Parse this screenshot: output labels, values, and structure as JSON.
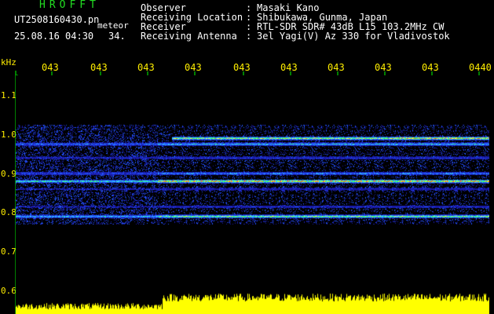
{
  "header": {
    "title": "HROFFT",
    "filename": "UT2508160430.pn",
    "meteor_label": "meteor",
    "datetime": "25.08.16 04:30",
    "count": "34."
  },
  "station": [
    {
      "label": "Observer",
      "value": "Masaki Kano"
    },
    {
      "label": "Receiving Location",
      "value": "Shibukawa, Gunma, Japan"
    },
    {
      "label": "Receiver",
      "value": "RTL-SDR SDR# 43dB L15 103.2MHz CW"
    },
    {
      "label": "Receiving Antenna",
      "value": "3el Yagi(V) Az 330 for Vladivostok"
    }
  ],
  "axes": {
    "unit_label": "kHz",
    "time_ticks": [
      "043",
      "043",
      "043",
      "043",
      "043",
      "043",
      "043",
      "043",
      "043",
      "0440"
    ],
    "freq_ticks": [
      "1.1",
      "1.0",
      "0.9",
      "0.8",
      "0.7",
      "0.6"
    ]
  },
  "colors": {
    "background": "#000000",
    "label_yellow": "#ffee00",
    "title_green": "#22dd22",
    "text_white": "#ffffff",
    "tick_green": "#00ff00"
  },
  "chart_data": {
    "type": "heatmap",
    "title": "",
    "xlabel": "",
    "ylabel": "kHz",
    "ylim": [
      0.6,
      1.15
    ],
    "time_ticks": [
      "043",
      "043",
      "043",
      "043",
      "043",
      "043",
      "043",
      "043",
      "043",
      "0440"
    ],
    "freq_ticks": [
      1.1,
      1.0,
      0.9,
      0.8,
      0.7,
      0.6
    ],
    "signal_lines_khz": [
      {
        "freq": 0.99,
        "strength": "strong, mainly right half"
      },
      {
        "freq": 0.975,
        "strength": "medium"
      },
      {
        "freq": 0.94,
        "strength": "weak"
      },
      {
        "freq": 0.9,
        "strength": "medium"
      },
      {
        "freq": 0.88,
        "strength": "strong"
      },
      {
        "freq": 0.86,
        "strength": "weak"
      },
      {
        "freq": 0.815,
        "strength": "weak"
      },
      {
        "freq": 0.79,
        "strength": "strong"
      }
    ],
    "amplitude_strip": "yellow, low on left, high from about 04:33 onward"
  }
}
